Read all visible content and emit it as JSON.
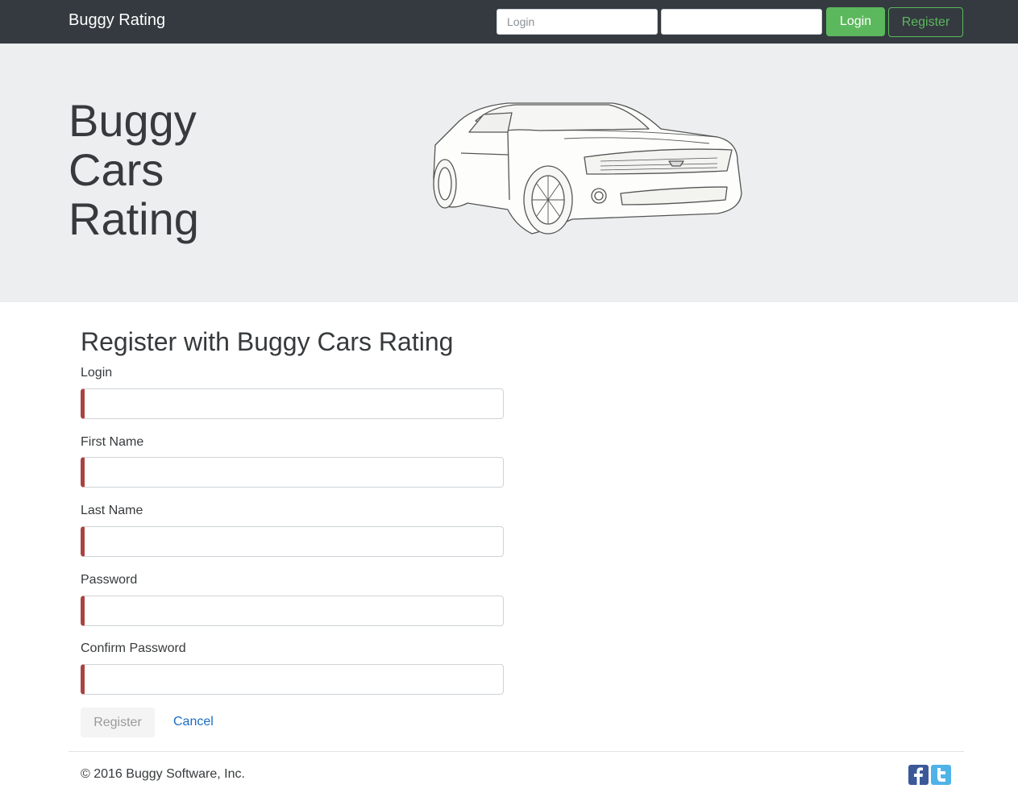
{
  "navbar": {
    "brand": "Buggy Rating",
    "login_placeholder": "Login",
    "password_placeholder": "",
    "login_button": "Login",
    "register_button": "Register"
  },
  "hero": {
    "title_lines": [
      "Buggy",
      "Cars",
      "Rating"
    ],
    "image_icon": "car-sketch"
  },
  "form": {
    "title": "Register with Buggy Cars Rating",
    "fields": [
      {
        "label": "Login",
        "value": ""
      },
      {
        "label": "First Name",
        "value": ""
      },
      {
        "label": "Last Name",
        "value": ""
      },
      {
        "label": "Password",
        "value": ""
      },
      {
        "label": "Confirm Password",
        "value": ""
      }
    ],
    "submit_label": "Register",
    "cancel_label": "Cancel",
    "invalid_color": "#a94442"
  },
  "footer": {
    "copyright": "© 2016 Buggy Software, Inc.",
    "social_icons": [
      "facebook-icon",
      "twitter-icon"
    ]
  },
  "colors": {
    "navbar_bg": "#343a40",
    "accent_green": "#5cb85c",
    "hero_bg": "#eceeef",
    "link_blue": "#1a6dc2"
  }
}
